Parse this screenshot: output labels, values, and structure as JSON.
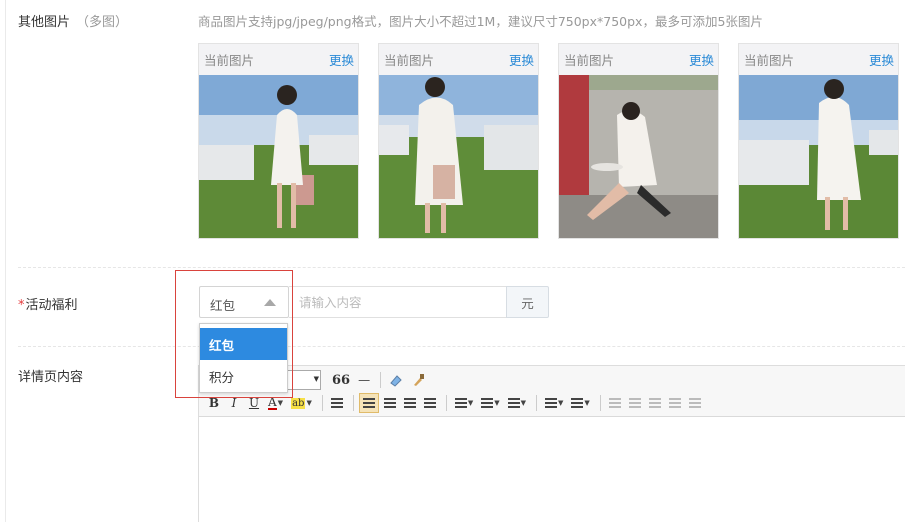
{
  "other_images": {
    "label": "其他图片",
    "sub_label": "（多图）",
    "hint": "商品图片支持jpg/jpeg/png格式，图片大小不超过1M，建议尺寸750px*750px，最多可添加5张图片",
    "items": [
      {
        "current_label": "当前图片",
        "change_label": "更换"
      },
      {
        "current_label": "当前图片",
        "change_label": "更换"
      },
      {
        "current_label": "当前图片",
        "change_label": "更换"
      },
      {
        "current_label": "当前图片",
        "change_label": "更换"
      }
    ]
  },
  "activity_benefit": {
    "required_mark": "*",
    "label": "活动福利",
    "select_value": "红包",
    "amount_placeholder": "请输入内容",
    "unit": "元",
    "options": [
      "红包",
      "积分"
    ],
    "selected_index": 0
  },
  "detail": {
    "label": "详情页内容"
  },
  "toolbar": {
    "quote_glyph": "66",
    "hr_glyph": "—",
    "bold": "B",
    "italic": "I",
    "underline": "U",
    "font_color": "A",
    "highlight": "ab"
  },
  "colors": {
    "accent": "#2d8ae0",
    "link": "#2a8ad6",
    "required": "#e4393c",
    "highlight_box": "#d9433d"
  }
}
